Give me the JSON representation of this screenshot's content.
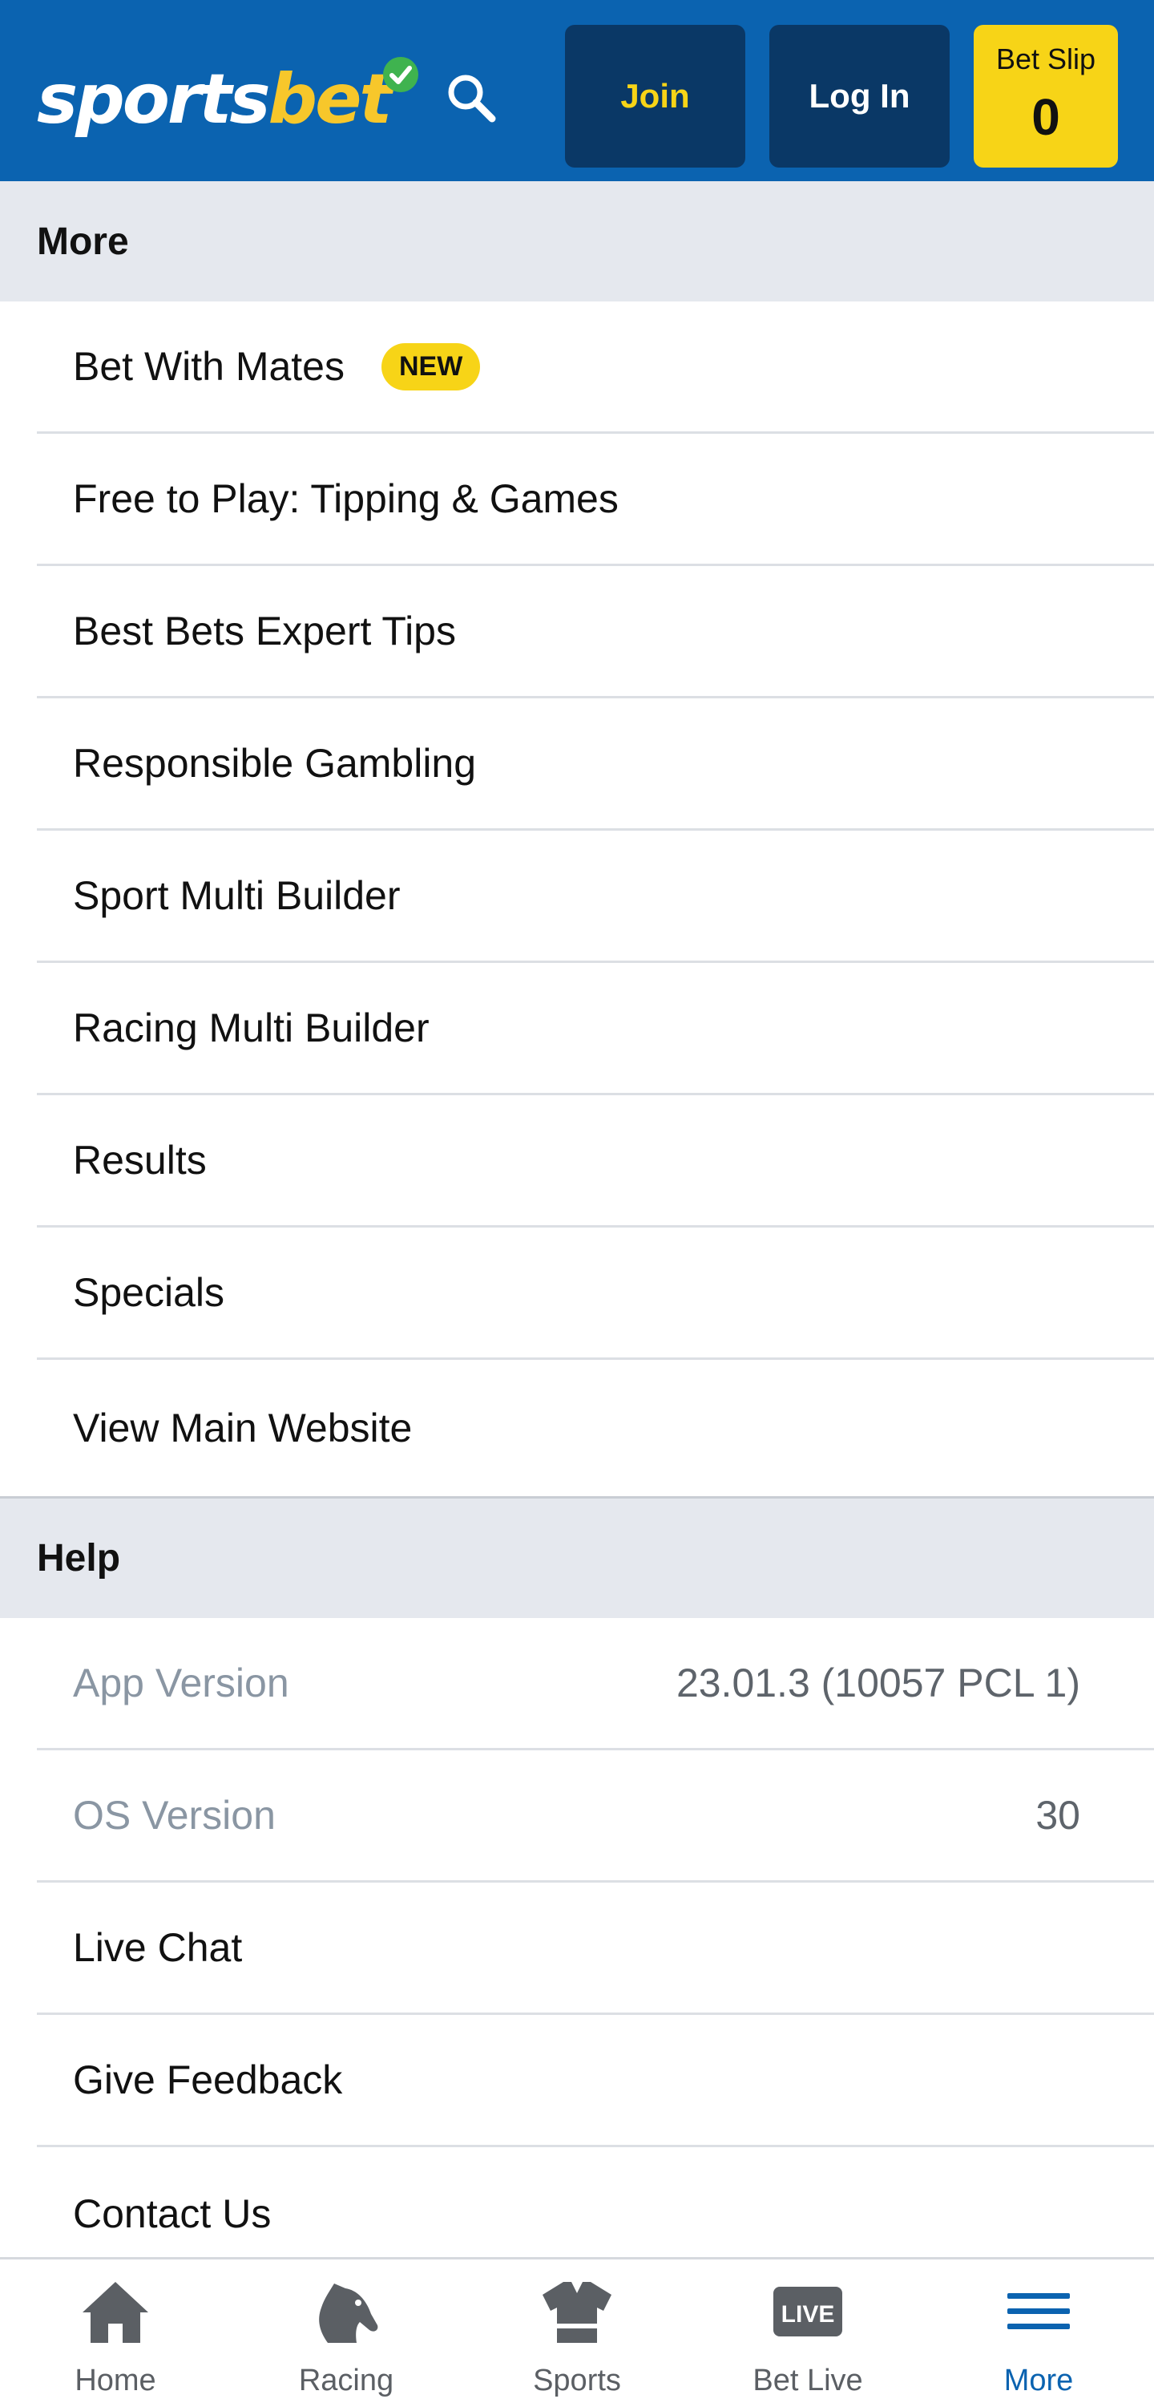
{
  "header": {
    "logo_part1": "sports",
    "logo_part2": "bet",
    "join_label": "Join",
    "login_label": "Log In",
    "betslip_label": "Bet Slip",
    "betslip_count": "0",
    "icons": [
      "search-icon",
      "check-badge-icon"
    ],
    "colors": {
      "brand_blue": "#0b63b0",
      "dark_button": "#0a3866",
      "accent_yellow": "#f7d417"
    }
  },
  "more": {
    "title": "More",
    "items": [
      {
        "label": "Bet With Mates",
        "badge": "NEW"
      },
      {
        "label": "Free to Play: Tipping & Games"
      },
      {
        "label": "Best Bets Expert Tips"
      },
      {
        "label": "Responsible Gambling"
      },
      {
        "label": "Sport Multi Builder"
      },
      {
        "label": "Racing Multi Builder"
      },
      {
        "label": "Results"
      },
      {
        "label": "Specials"
      },
      {
        "label": "View Main Website"
      }
    ]
  },
  "help": {
    "title": "Help",
    "app_version_label": "App Version",
    "app_version_value": "23.01.3 (10057 PCL 1)",
    "os_version_label": "OS Version",
    "os_version_value": "30",
    "items": [
      {
        "label": "Live Chat"
      },
      {
        "label": "Give Feedback"
      },
      {
        "label": "Contact Us"
      }
    ]
  },
  "bottom_nav": {
    "items": [
      {
        "label": "Home",
        "icon": "home-icon"
      },
      {
        "label": "Racing",
        "icon": "horse-icon"
      },
      {
        "label": "Sports",
        "icon": "jersey-icon"
      },
      {
        "label": "Bet Live",
        "icon": "live-icon"
      },
      {
        "label": "More",
        "icon": "menu-icon",
        "active": true
      }
    ]
  }
}
